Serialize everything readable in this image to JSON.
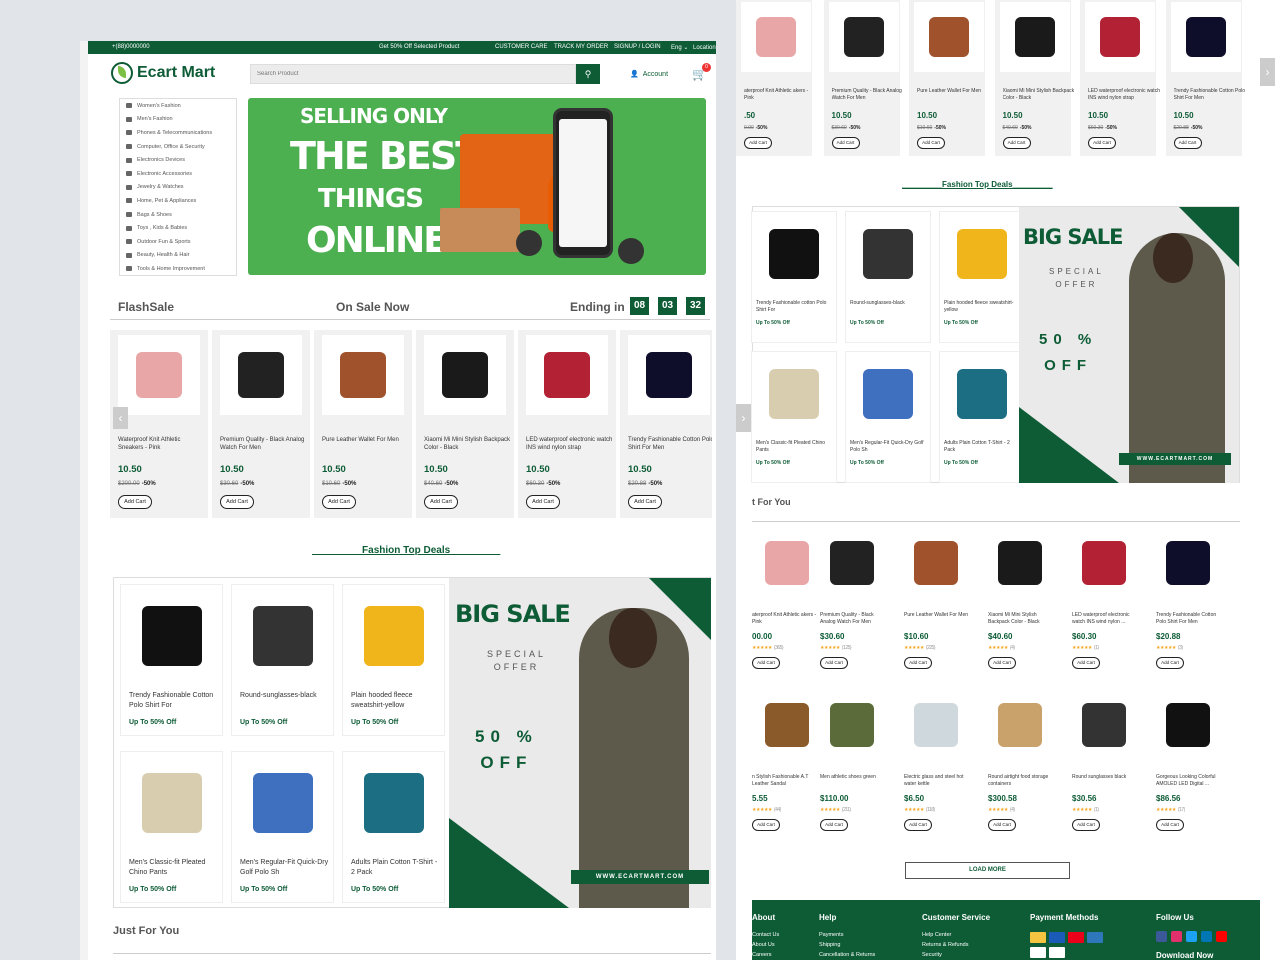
{
  "topbar": {
    "phone": "+(88)0000000",
    "promo": "Get 50% Off Selected Product",
    "customer_care": "CUSTOMER CARE",
    "track": "TRACK MY ORDER",
    "signup": "SIGNUP / LOGIN",
    "lang": "Eng",
    "location": "Location"
  },
  "header": {
    "logo": "Ecart Mart",
    "search_placeholder": "Search Product",
    "account": "Account",
    "cart_count": "0"
  },
  "categories": [
    "Women's Fashion",
    "Men's Fashion",
    "Phones & Telecommunications",
    "Computer, Office & Security",
    "Electronics Devices",
    "Electronic Accessories",
    "Jewelry & Watches",
    "Home, Pet & Appliances",
    "Bags & Shoes",
    "Toys , Kids & Babies",
    "Outdoor Fun & Sports",
    "Beauty, Health & Hair",
    "Tools & Home Improvement"
  ],
  "banner": {
    "line1": "SELLING ONLY",
    "line2": "THE BEST",
    "line3": "THINGS",
    "line4": "ONLINE"
  },
  "flash": {
    "title": "FlashSale",
    "subtitle": "On Sale Now",
    "ending": "Ending in",
    "hours": "08",
    "minutes": "03",
    "seconds": "32"
  },
  "products": [
    {
      "name": "Waterproof Knit Athletic Sneakers - Pink",
      "price": "10.50",
      "old": "$200.00",
      "off": "-50%",
      "icon": "sneaker-icon",
      "color": "#e8a6a6"
    },
    {
      "name": "Premium Quality - Black Analog Watch For Men",
      "price": "10.50",
      "old": "$30.60",
      "off": "-50%",
      "icon": "watch-icon",
      "color": "#222222"
    },
    {
      "name": "Pure Leather Wallet For Men",
      "price": "10.50",
      "old": "$10.60",
      "off": "-50%",
      "icon": "wallet-icon",
      "color": "#a0522d"
    },
    {
      "name": "Xiaomi Mi Mini Stylish Backpack Color - Black",
      "price": "10.50",
      "old": "$40.60",
      "off": "-50%",
      "icon": "backpack-icon",
      "color": "#1a1a1a"
    },
    {
      "name": "LED waterproof electronic watch INS wind nylon strap",
      "price": "10.50",
      "old": "$60.30",
      "off": "-50%",
      "icon": "smartwatch-icon",
      "color": "#b22234"
    },
    {
      "name": "Trendy Fashionable Cotton Polo Shirt For Men",
      "price": "10.50",
      "old": "$20.88",
      "off": "-50%",
      "icon": "polo-shirt-icon",
      "color": "#0e0e2a"
    }
  ],
  "add_cart": "Add Cart",
  "fashion": {
    "title": "_________Fashion Top Deals_________",
    "title_right": "_________Fashion Top Deals_________",
    "items": [
      {
        "name": "Trendy Fashionable Cotton Polo Shirt For",
        "off": "Up To 50% Off",
        "icon": "polo-shirt-icon",
        "color": "#111"
      },
      {
        "name": "Round-sunglasses-black",
        "off": "Up To 50% Off",
        "icon": "sunglasses-icon",
        "color": "#333"
      },
      {
        "name": "Plain hooded fleece sweatshirt-yellow",
        "off": "Up To 50% Off",
        "icon": "hoodie-icon",
        "color": "#f1b51c"
      },
      {
        "name": "Men's Classic-fit Pleated Chino Pants",
        "off": "Up To 50% Off",
        "icon": "pants-icon",
        "color": "#d9cdb0"
      },
      {
        "name": "Men's Regular-Fit Quick-Dry Golf Polo Sh",
        "off": "Up To 50% Off",
        "icon": "golf-polo-icon",
        "color": "#3f6fbf"
      },
      {
        "name": "Adults Plain Cotton T-Shirt - 2 Pack",
        "off": "Up To 50% Off",
        "icon": "tshirt-icon",
        "color": "#1c6e82"
      }
    ],
    "sale_title": "BIG SALE",
    "sale_special": "SPECIAL",
    "sale_offer": "OFFER",
    "sale_pct": "50 %",
    "sale_off": "OFF",
    "sale_url": "WWW.ECARTMART.COM"
  },
  "just_for_you": "Just For You",
  "just_for_you_right": "t For You",
  "right": {
    "top_row": [
      {
        "name": "aterproof Knit Athletic akers - Pink",
        "price": ".50",
        "old": "0.00",
        "off": "-50%"
      },
      {
        "name": "Premium Quality - Black Analog Watch For Men",
        "price": "10.50",
        "old": "$30.60",
        "off": "-50%"
      },
      {
        "name": "Pure Leather Wallet For Men",
        "price": "10.50",
        "old": "$10.60",
        "off": "-50%"
      },
      {
        "name": "Xiaomi Mi Mini Stylish Backpack Color - Black",
        "price": "10.50",
        "old": "$40.60",
        "off": "-50%"
      },
      {
        "name": "LED waterproof electronic watch INS wind nylon strap",
        "price": "10.50",
        "old": "$60.30",
        "off": "-50%"
      },
      {
        "name": "Trendy Fashionable Cotton Polo Shirt For Men",
        "price": "10.50",
        "old": "$20.88",
        "off": "-50%"
      }
    ],
    "fashion_items": [
      {
        "name": "Trendy Fashionable cotton Polo Shirt For",
        "off": "Up To 50% Off"
      },
      {
        "name": "Round-sunglasses-black",
        "off": "Up To 50% Off"
      },
      {
        "name": "Plain hooded fleece sweatshirt-yellow",
        "off": "Up To 50% Off"
      },
      {
        "name": "Men's Classic-fit Pleated Chino Pants",
        "off": "Up To 50% Off"
      },
      {
        "name": "Men's Regular-Fit Quick-Dry Golf Polo Sh",
        "off": "Up To 50% Off"
      },
      {
        "name": "Adults Plain Cotton T-Shirt - 2 Pack",
        "off": "Up To 50% Off"
      }
    ],
    "jfy_row1": [
      {
        "name": "aterproof Knit Athletic akers - Pink",
        "price": "00.00",
        "reviews": "(365)"
      },
      {
        "name": "Premium Quality - Black Analog Watch For Men",
        "price": "$30.60",
        "reviews": "(125)"
      },
      {
        "name": "Pure Leather Wallet For Men",
        "price": "$10.60",
        "reviews": "(225)"
      },
      {
        "name": "Xiaomi Mi Mini Stylish Backpack Color - Black",
        "price": "$40.60",
        "reviews": "(4)"
      },
      {
        "name": "LED waterproof electronic watch INS wind nylon ...",
        "price": "$60.30",
        "reviews": "(1)"
      },
      {
        "name": "Trendy Fashionable Cotton Polo Shirt For Men",
        "price": "$20.88",
        "reviews": "(3)"
      }
    ],
    "jfy_row2": [
      {
        "name": "n Stylish Fashionable A.T Leather Sandal",
        "price": "5.55",
        "reviews": "(44)"
      },
      {
        "name": "Men athletic shoes green",
        "price": "$110.00",
        "reviews": "(211)"
      },
      {
        "name": "Electric glass and steel hot water kettle",
        "price": "$6.50",
        "reviews": "(118)"
      },
      {
        "name": "Round airtight food storage containers",
        "price": "$300.58",
        "reviews": "(4)"
      },
      {
        "name": "Round sunglasses black",
        "price": "$30.56",
        "reviews": "(1)"
      },
      {
        "name": "Gorgeous Looking Colorful AMOLED LED Digital ...",
        "price": "$86.56",
        "reviews": "(17)"
      }
    ],
    "load_more": "LOAD MORE",
    "footer": {
      "about": "About",
      "about_links": [
        "Contact Us",
        "About Us",
        "Careers"
      ],
      "help": "Help",
      "help_links": [
        "Payments",
        "Shipping",
        "Cancellation & Returns"
      ],
      "customer_service": "Customer Service",
      "cs_links": [
        "Help Center",
        "Returns & Refunds",
        "Security"
      ],
      "payment": "Payment Methods",
      "follow": "Follow Us",
      "download": "Download Now"
    }
  }
}
